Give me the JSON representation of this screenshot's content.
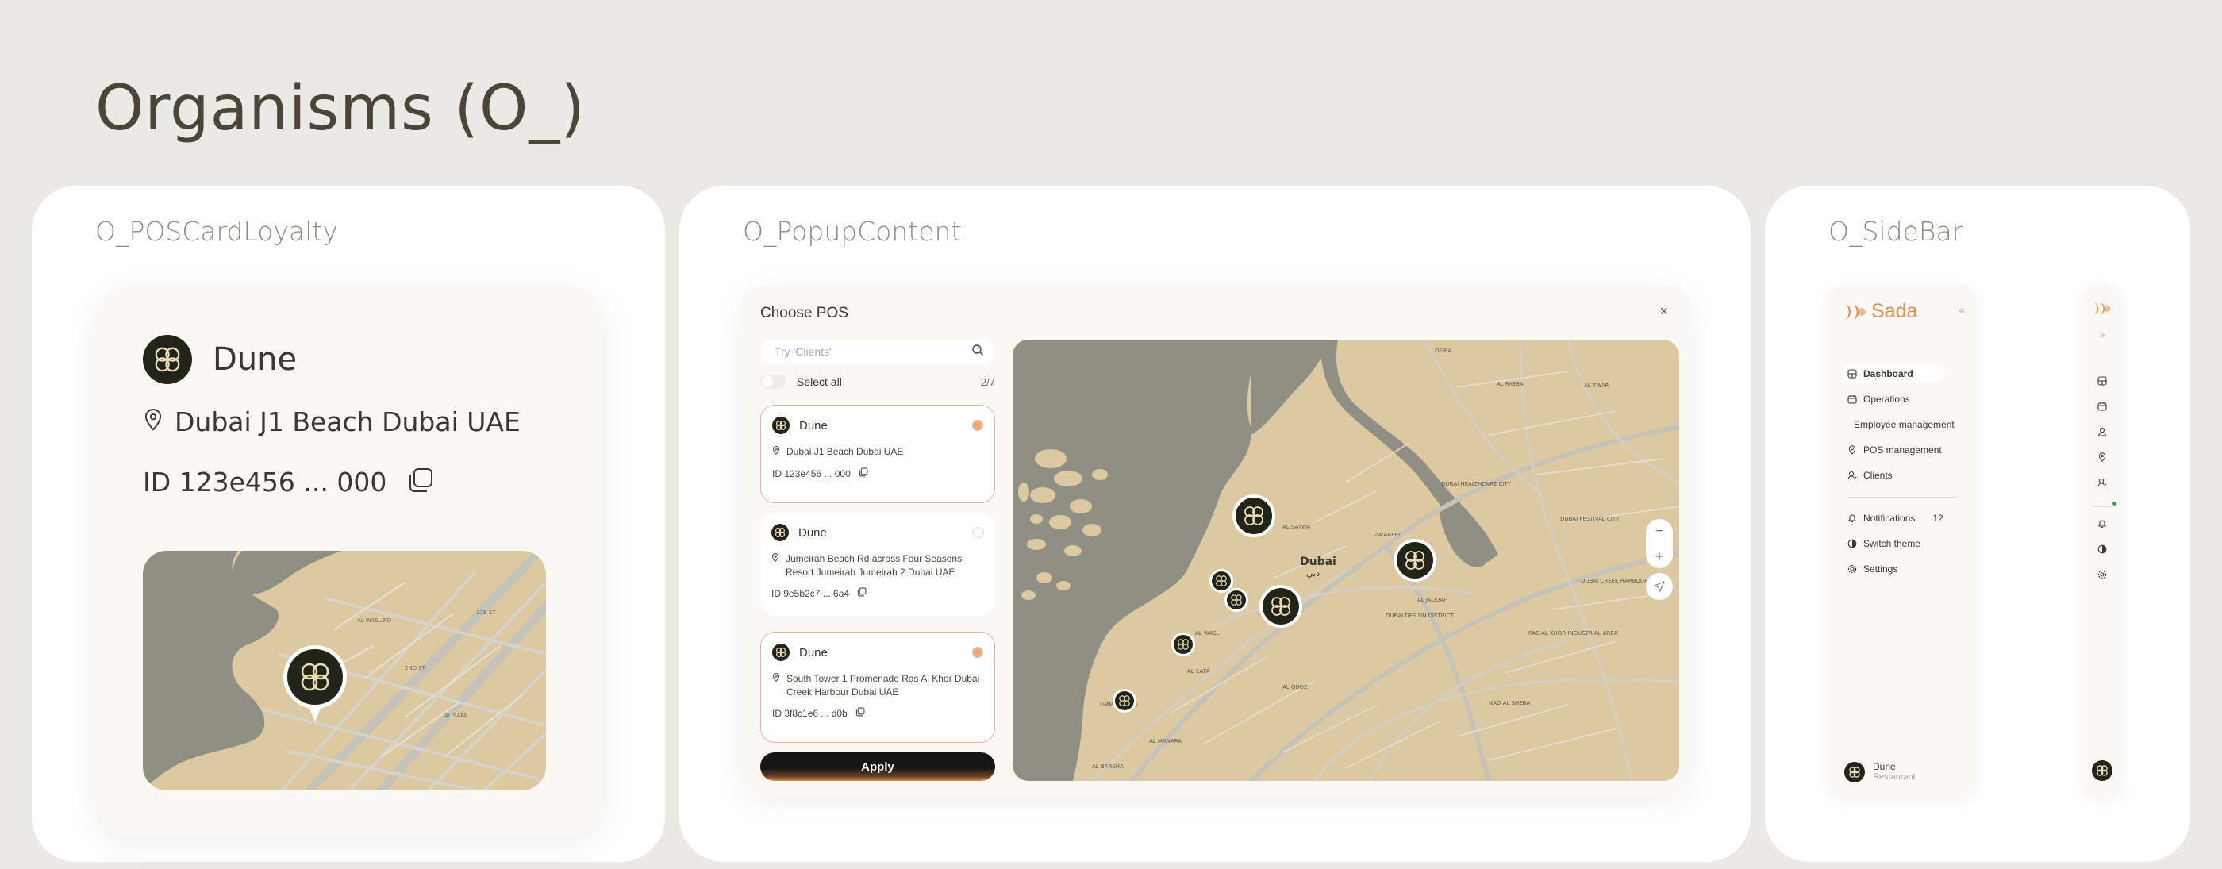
{
  "page": {
    "title": "Organisms (O_)"
  },
  "colors": {
    "background": "#ebe9e6",
    "panel": "#ffffff",
    "card": "#faf8f4",
    "accent": "#e08f4f",
    "brand_dark": "#232419",
    "map_land": "#dcc9a1",
    "map_water": "#8f9083"
  },
  "loyalty": {
    "label": "O_POSCardLoyalty",
    "name": "Dune",
    "address": "Dubai J1 Beach Dubai UAE",
    "id": "ID 123e456 ... 000",
    "icons": {
      "logo": "brand-knot-icon",
      "location": "location-pin-icon",
      "copy": "copy-icon"
    }
  },
  "popup": {
    "label": "O_PopupContent",
    "title": "Choose POS",
    "close": "×",
    "search_placeholder": "Try 'Clients'",
    "select_all": "Select all",
    "select_count": "2/7",
    "apply": "Apply",
    "cards": [
      {
        "name": "Dune",
        "address": "Dubai J1 Beach Dubai UAE",
        "id": "ID 123e456 ... 000",
        "selected": true
      },
      {
        "name": "Dune",
        "address": "Jumeirah Beach Rd across Four Seasons Resort Jumeirah Jumeirah 2 Dubai UAE",
        "id": "ID 9e5b2c7 ... 6a4",
        "selected": false
      },
      {
        "name": "Dune",
        "address": "South Tower 1 Promenade Ras Al Khor Dubai Creek Harbour Dubai UAE",
        "id": "ID 3f8c1e6 ... d0b",
        "selected": true
      }
    ],
    "map": {
      "city_label": "Dubai",
      "city_label_ar": "دبي",
      "controls": {
        "zoom_in": "+",
        "zoom_out": "−"
      },
      "districts": [
        "DEIRA",
        "AL RIGGA",
        "AL TWAR",
        "AL SATWA",
        "ZA'ABEEL 1",
        "DUBAI HEALTHCARE CITY",
        "DUBAI FESTIVAL CITY",
        "DUBAI CREEK HARBOUR",
        "AL QUOZ",
        "AL WASL",
        "UMM SUQEIM",
        "AL MANARA",
        "NAD AL SHEBA",
        "RAS AL KHOR INDUSTRIAL AREA",
        "AL JADDAF",
        "DUBAI DESIGN DISTRICT",
        "AL SAFA",
        "AL BARSHA"
      ]
    }
  },
  "sidebar": {
    "label": "O_SideBar",
    "brand": "Sada",
    "nav": [
      {
        "label": "Dashboard",
        "icon": "dashboard-icon",
        "active": true
      },
      {
        "label": "Operations",
        "icon": "calendar-icon",
        "active": false
      },
      {
        "label": "Employee management",
        "icon": "users-icon",
        "active": false
      },
      {
        "label": "POS management",
        "icon": "location-pin-icon",
        "active": false
      },
      {
        "label": "Clients",
        "icon": "client-icon",
        "active": false
      }
    ],
    "secondary": [
      {
        "label": "Notifications",
        "icon": "bell-icon",
        "badge": "12"
      },
      {
        "label": "Switch theme",
        "icon": "theme-icon"
      },
      {
        "label": "Settings",
        "icon": "gear-icon"
      }
    ],
    "user": {
      "name": "Dune",
      "role": "Restaurant"
    }
  }
}
